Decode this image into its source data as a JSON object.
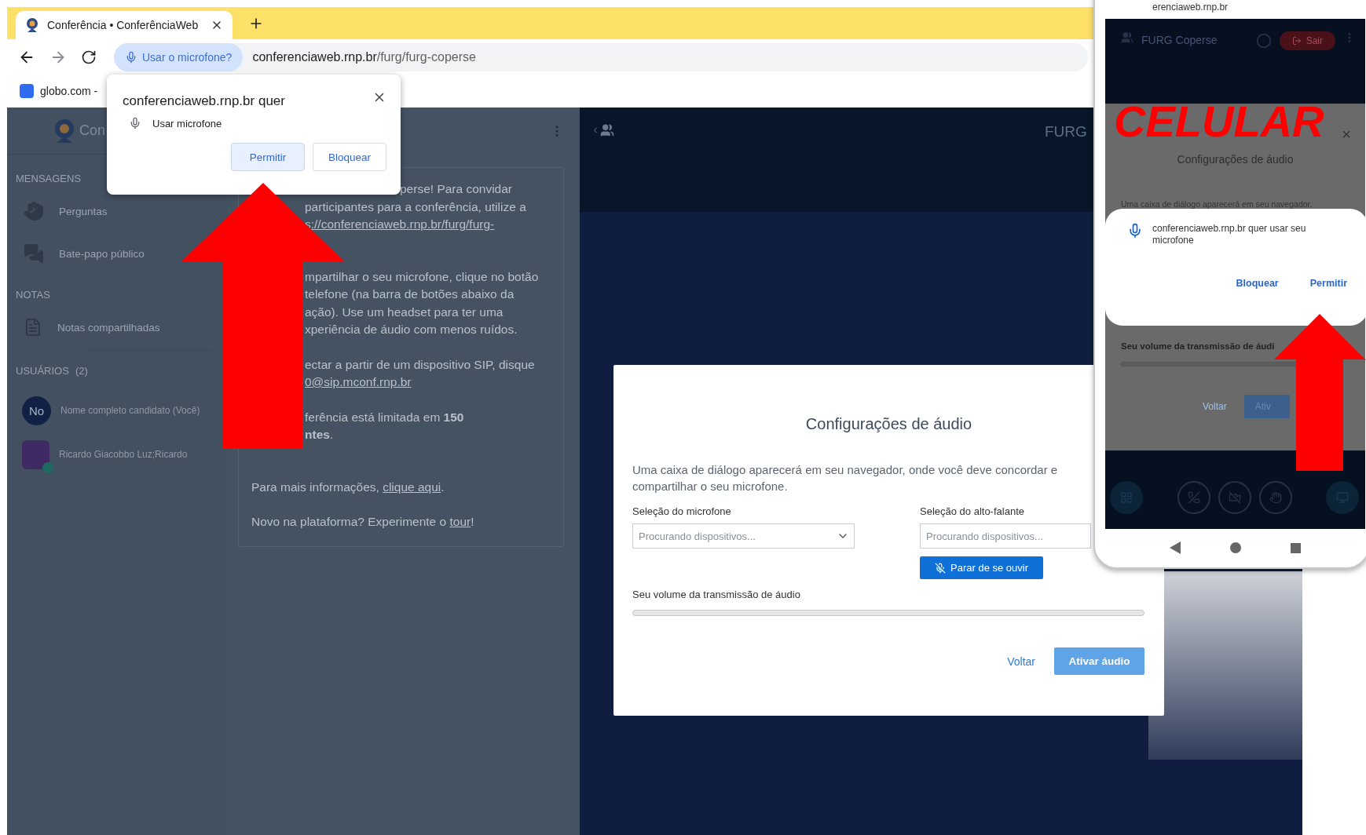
{
  "browser": {
    "tab": {
      "title": "Conferência • ConferênciaWeb",
      "selected": true
    },
    "permission_chip": "Usar o microfone?",
    "url": {
      "host": "conferenciaweb.rnp.br",
      "path": "/furg/furg-coperse"
    },
    "bookmark": "globo.com -"
  },
  "permission_popup": {
    "title": "conferenciaweb.rnp.br quer",
    "permission": "Usar microfone",
    "buttons": [
      {
        "label": "Permitir",
        "selected": true
      },
      {
        "label": "Bloquear",
        "selected": false
      }
    ]
  },
  "sidebar": {
    "logo_text": "Con",
    "sections": [
      {
        "title": "MENSAGENS",
        "items": [
          {
            "label": "Perguntas",
            "kind": "hand"
          },
          {
            "label": "Bate-papo público",
            "kind": "chat"
          }
        ]
      },
      {
        "title": "NOTAS",
        "items": [
          {
            "label": "Notas compartilhadas",
            "kind": "note"
          }
        ]
      }
    ],
    "users_title": "USUÁRIOS",
    "users_count": "(2)",
    "users": [
      {
        "kind": "initials",
        "initials": "No",
        "name": "Nome completo candidato (Você)"
      },
      {
        "kind": "photo",
        "name": "Ricardo Giacobbo Luz;Ricardo"
      }
    ]
  },
  "chat_welcome": {
    "paragraphs": [
      {
        "clipped": true,
        "lines": [
          [
            {
              "text": "perse! Para convidar",
              "link": false
            }
          ],
          [
            {
              "text": "participantes para a conferência, utilize a",
              "link": false
            }
          ],
          [
            {
              "text": "s://conferenciaweb.rnp.br/furg/furg-",
              "link": true
            }
          ]
        ]
      },
      {
        "clipped": true,
        "lines": [
          [
            {
              "text": "mpartilhar o seu microfone, clique no botão",
              "link": false
            }
          ],
          [
            {
              "text": "telefone (na barra de botões abaixo da",
              "link": false
            }
          ],
          [
            {
              "text": "ação). Use um headset para ter uma",
              "link": false
            }
          ],
          [
            {
              "text": "xperiência de áudio com menos ruídos.",
              "link": false
            }
          ]
        ]
      },
      {
        "clipped": true,
        "lines": [
          [
            {
              "text": "ectar a partir de um dispositivo SIP, disque",
              "link": false
            }
          ],
          [
            {
              "text": "0@sip.mconf.rnp.br",
              "link": true
            }
          ]
        ]
      },
      {
        "clipped": true,
        "lines": [
          [
            {
              "text": "ferência está limitada em **150**",
              "link": false
            }
          ],
          [
            {
              "text": "**ntes**.",
              "link": false
            }
          ]
        ]
      },
      {
        "clipped": false,
        "lines": [
          [
            {
              "text": "Para mais informações, ",
              "link": false
            },
            {
              "text": "clique aqui",
              "link": true
            },
            {
              "text": ".",
              "link": false
            }
          ]
        ]
      },
      {
        "clipped": false,
        "lines": [
          [
            {
              "text": "Novo na plataforma? Experimente o ",
              "link": false
            },
            {
              "text": "tour",
              "link": true
            },
            {
              "text": "!",
              "link": false
            }
          ]
        ]
      }
    ]
  },
  "main_header": {
    "title": "FURG"
  },
  "audio_dialog": {
    "title": "Configurações de áudio",
    "description_lines": [
      "Uma caixa de diálogo aparecerá em seu navegador, onde você deve concordar e",
      "compartilhar o seu microfone."
    ],
    "microphone": {
      "label": "Seleção do microfone",
      "placeholder": "Procurando dispositivos..."
    },
    "speaker": {
      "label": "Seleção do alto-falante",
      "placeholder": "Procurando dispositivos..."
    },
    "listen_button": "Parar de se ouvir",
    "volume": {
      "label": "Seu volume da transmissão de áudio",
      "level": 0
    },
    "back": "Voltar",
    "activate": {
      "label": "Ativar áudio",
      "disabled": true
    }
  },
  "phone": {
    "address": "erenciaweb.rnp.br",
    "header_title": "FURG Coperse",
    "leave_button": "Sair",
    "overlay_label": "CELULAR",
    "close": "×",
    "dialog_title": "Configurações de áudio",
    "dialog_text": "Uma caixa de diálogo aparecerá em seu navegador.",
    "permission": {
      "text": "conferenciaweb.rnp.br quer usar seu microfone",
      "buttons": [
        {
          "label": "Bloquear"
        },
        {
          "label": "Permitir"
        }
      ]
    },
    "volume_label": "Seu volume da transmissão de áudi",
    "back": "Voltar",
    "activate": "Ativ"
  }
}
